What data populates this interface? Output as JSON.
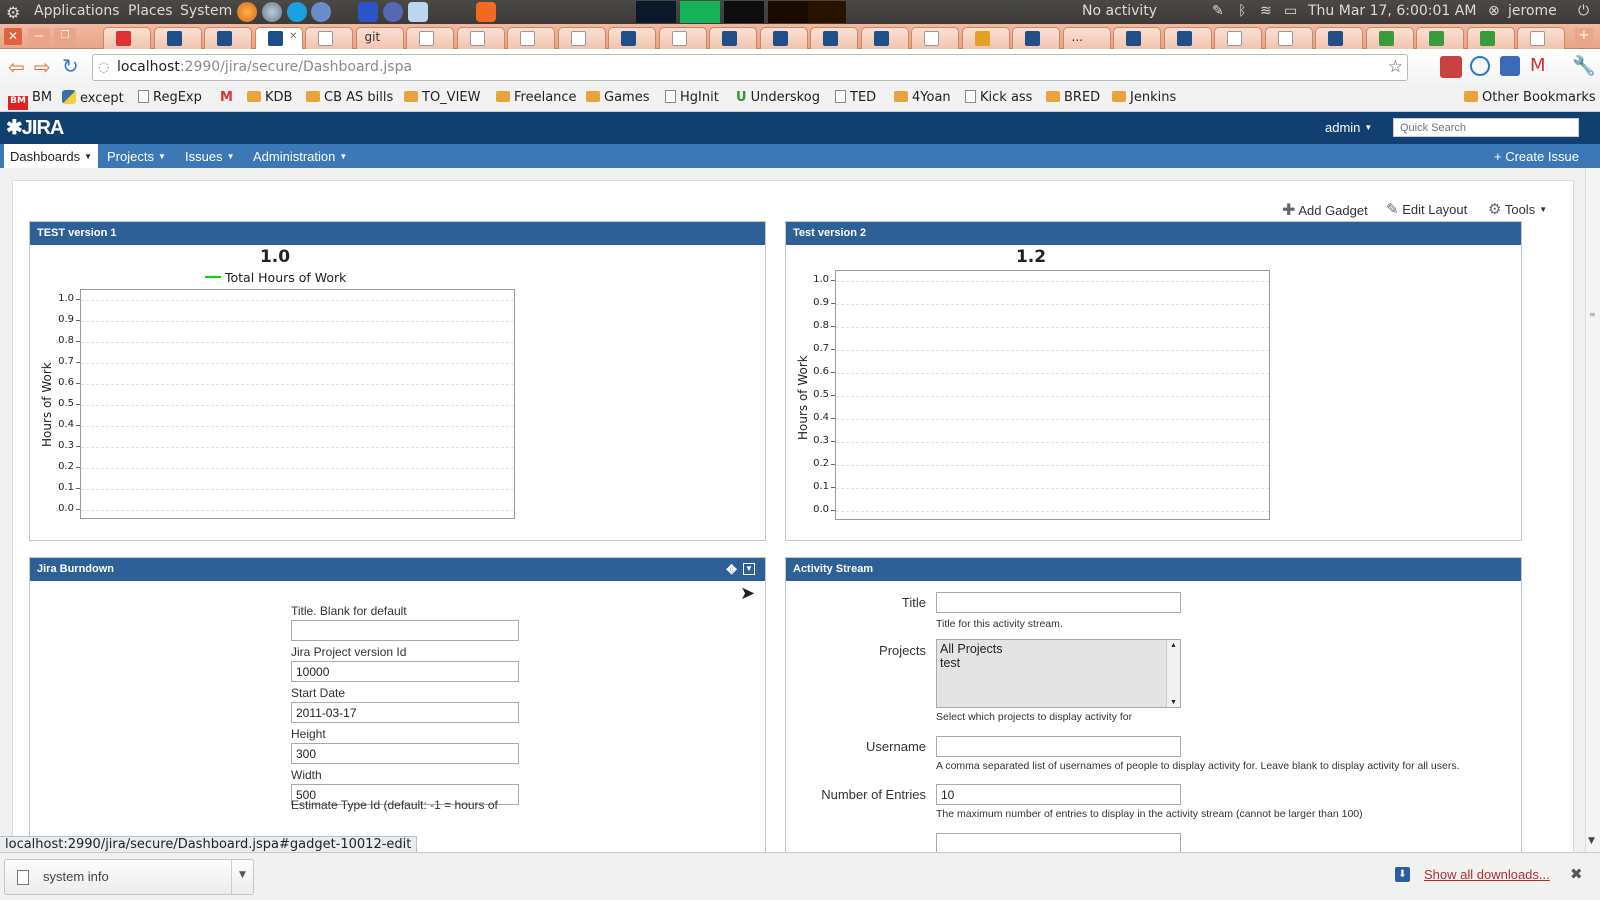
{
  "os_panel": {
    "menus": [
      "Applications",
      "Places",
      "System"
    ],
    "status": "No activity",
    "datetime": "Thu Mar 17,  6:00:01 AM",
    "user": "jerome"
  },
  "browser": {
    "tabs": [
      {
        "icon": "gmail-icon"
      },
      {
        "icon": "jira-icon"
      },
      {
        "icon": "jira-icon"
      },
      {
        "icon": "jira-icon",
        "active": true
      },
      {
        "icon": "page-icon"
      },
      {
        "label": "git"
      },
      {
        "icon": "page-icon"
      },
      {
        "icon": "page-icon"
      },
      {
        "icon": "page-icon"
      },
      {
        "icon": "page-icon"
      },
      {
        "icon": "jira-icon"
      },
      {
        "icon": "page-icon"
      },
      {
        "icon": "jira-icon"
      },
      {
        "icon": "jira-icon"
      },
      {
        "icon": "jira-icon"
      },
      {
        "icon": "jira-icon"
      },
      {
        "icon": "page-icon"
      },
      {
        "icon": "image-icon"
      },
      {
        "icon": "jira-icon"
      },
      {
        "label": "..."
      },
      {
        "icon": "jira-icon"
      },
      {
        "icon": "jira-icon"
      },
      {
        "icon": "page-icon"
      },
      {
        "icon": "page-icon"
      },
      {
        "icon": "jira-icon"
      },
      {
        "icon": "google-icon"
      },
      {
        "icon": "google-icon"
      },
      {
        "icon": "google-icon"
      },
      {
        "icon": "page-icon"
      }
    ],
    "url_host": "localhost",
    "url_path": ":2990/jira/secure/Dashboard.jspa",
    "bookmarks": [
      {
        "label": "BM",
        "icon": "bm-icon"
      },
      {
        "label": "except",
        "icon": "python-icon"
      },
      {
        "label": "RegExp",
        "icon": "page-icon"
      },
      {
        "label": "",
        "icon": "gmail-icon"
      },
      {
        "label": "KDB",
        "icon": "folder-icon"
      },
      {
        "label": "CB AS bills",
        "icon": "folder-icon"
      },
      {
        "label": "TO_VIEW",
        "icon": "folder-icon"
      },
      {
        "label": "Freelance",
        "icon": "folder-icon"
      },
      {
        "label": "Games",
        "icon": "folder-icon"
      },
      {
        "label": "HgInit",
        "icon": "page-icon"
      },
      {
        "label": "Underskog",
        "icon": "u-icon"
      },
      {
        "label": "TED",
        "icon": "page-icon"
      },
      {
        "label": "4Yoan",
        "icon": "folder-icon"
      },
      {
        "label": "Kick ass",
        "icon": "page-icon"
      },
      {
        "label": "BRED",
        "icon": "folder-icon"
      },
      {
        "label": "Jenkins",
        "icon": "folder-icon"
      }
    ],
    "other_bookmarks": "Other Bookmarks",
    "status_url": "localhost:2990/jira/secure/Dashboard.jspa#gadget-10012-edit"
  },
  "jira": {
    "logo": "JIRA",
    "user": "admin",
    "search_placeholder": "Quick Search",
    "nav": [
      "Dashboards",
      "Projects",
      "Issues",
      "Administration"
    ],
    "create_issue": "Create Issue",
    "tools": {
      "add_gadget": "Add Gadget",
      "edit_layout": "Edit Layout",
      "tools": "Tools"
    }
  },
  "gadgets": {
    "g1": {
      "title": "TEST version 1",
      "chart_title": "1.0",
      "legend": "Total Hours of Work",
      "ylabel": "Hours of Work"
    },
    "g2": {
      "title": "Test version 2",
      "chart_title": "1.2",
      "ylabel": "Hours of Work"
    },
    "burndown": {
      "title": "Jira Burndown",
      "fields": [
        {
          "label": "Title. Blank for default",
          "value": ""
        },
        {
          "label": "Jira Project version Id",
          "value": "10000"
        },
        {
          "label": "Start Date",
          "value": "2011-03-17"
        },
        {
          "label": "Height",
          "value": "300"
        },
        {
          "label": "Width",
          "value": "500"
        }
      ],
      "estimate_label": "Estimate Type Id (default: -1 = hours of"
    },
    "activity": {
      "title": "Activity Stream",
      "title_label": "Title",
      "title_value": "",
      "title_desc": "Title for this activity stream.",
      "projects_label": "Projects",
      "projects_options": [
        "All Projects",
        "test"
      ],
      "projects_desc": "Select which projects to display activity for",
      "username_label": "Username",
      "username_value": "",
      "username_desc": "A comma separated list of usernames of people to display activity for. Leave blank to display activity for all users.",
      "entries_label": "Number of Entries",
      "entries_value": "10",
      "entries_desc": "The maximum number of entries to display in the activity stream (cannot be larger than 100)"
    }
  },
  "downloads": {
    "item": "system info",
    "show_all": "Show all downloads..."
  },
  "chart_data": [
    {
      "type": "line",
      "title": "1.0",
      "ylabel": "Hours of Work",
      "ylim": [
        0.0,
        1.0
      ],
      "yticks": [
        "1.0",
        "0.9",
        "0.8",
        "0.7",
        "0.6",
        "0.5",
        "0.4",
        "0.3",
        "0.2",
        "0.1",
        "0.0"
      ],
      "series": [
        {
          "name": "Total Hours of Work",
          "values": [],
          "color": "#00dd00"
        }
      ],
      "grid": true,
      "legend": "top"
    },
    {
      "type": "line",
      "title": "1.2",
      "ylabel": "Hours of Work",
      "ylim": [
        0.0,
        1.0
      ],
      "yticks": [
        "1.0",
        "0.9",
        "0.8",
        "0.7",
        "0.6",
        "0.5",
        "0.4",
        "0.3",
        "0.2",
        "0.1",
        "0.0"
      ],
      "series": [],
      "grid": true
    }
  ]
}
